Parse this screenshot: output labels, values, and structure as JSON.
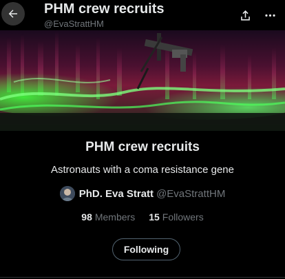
{
  "header": {
    "title": "PHM crew recruits",
    "handle": "@EvaStrattHM",
    "back_icon": "arrow-left-icon",
    "share_icon": "share-icon",
    "more_icon": "more-horizontal-icon"
  },
  "banner": {
    "description": "aurora-from-space-station-image"
  },
  "list": {
    "name": "PHM crew recruits",
    "description": "Astronauts with a coma resistance gene"
  },
  "owner": {
    "name": "PhD. Eva Stratt",
    "handle": "@EvaStrattHM"
  },
  "stats": {
    "members_count": "98",
    "members_label": "Members",
    "followers_count": "15",
    "followers_label": "Followers"
  },
  "actions": {
    "follow_label": "Following"
  },
  "colors": {
    "background": "#000000",
    "text": "#e7e9ea",
    "muted": "#71767b",
    "border": "#536471"
  }
}
